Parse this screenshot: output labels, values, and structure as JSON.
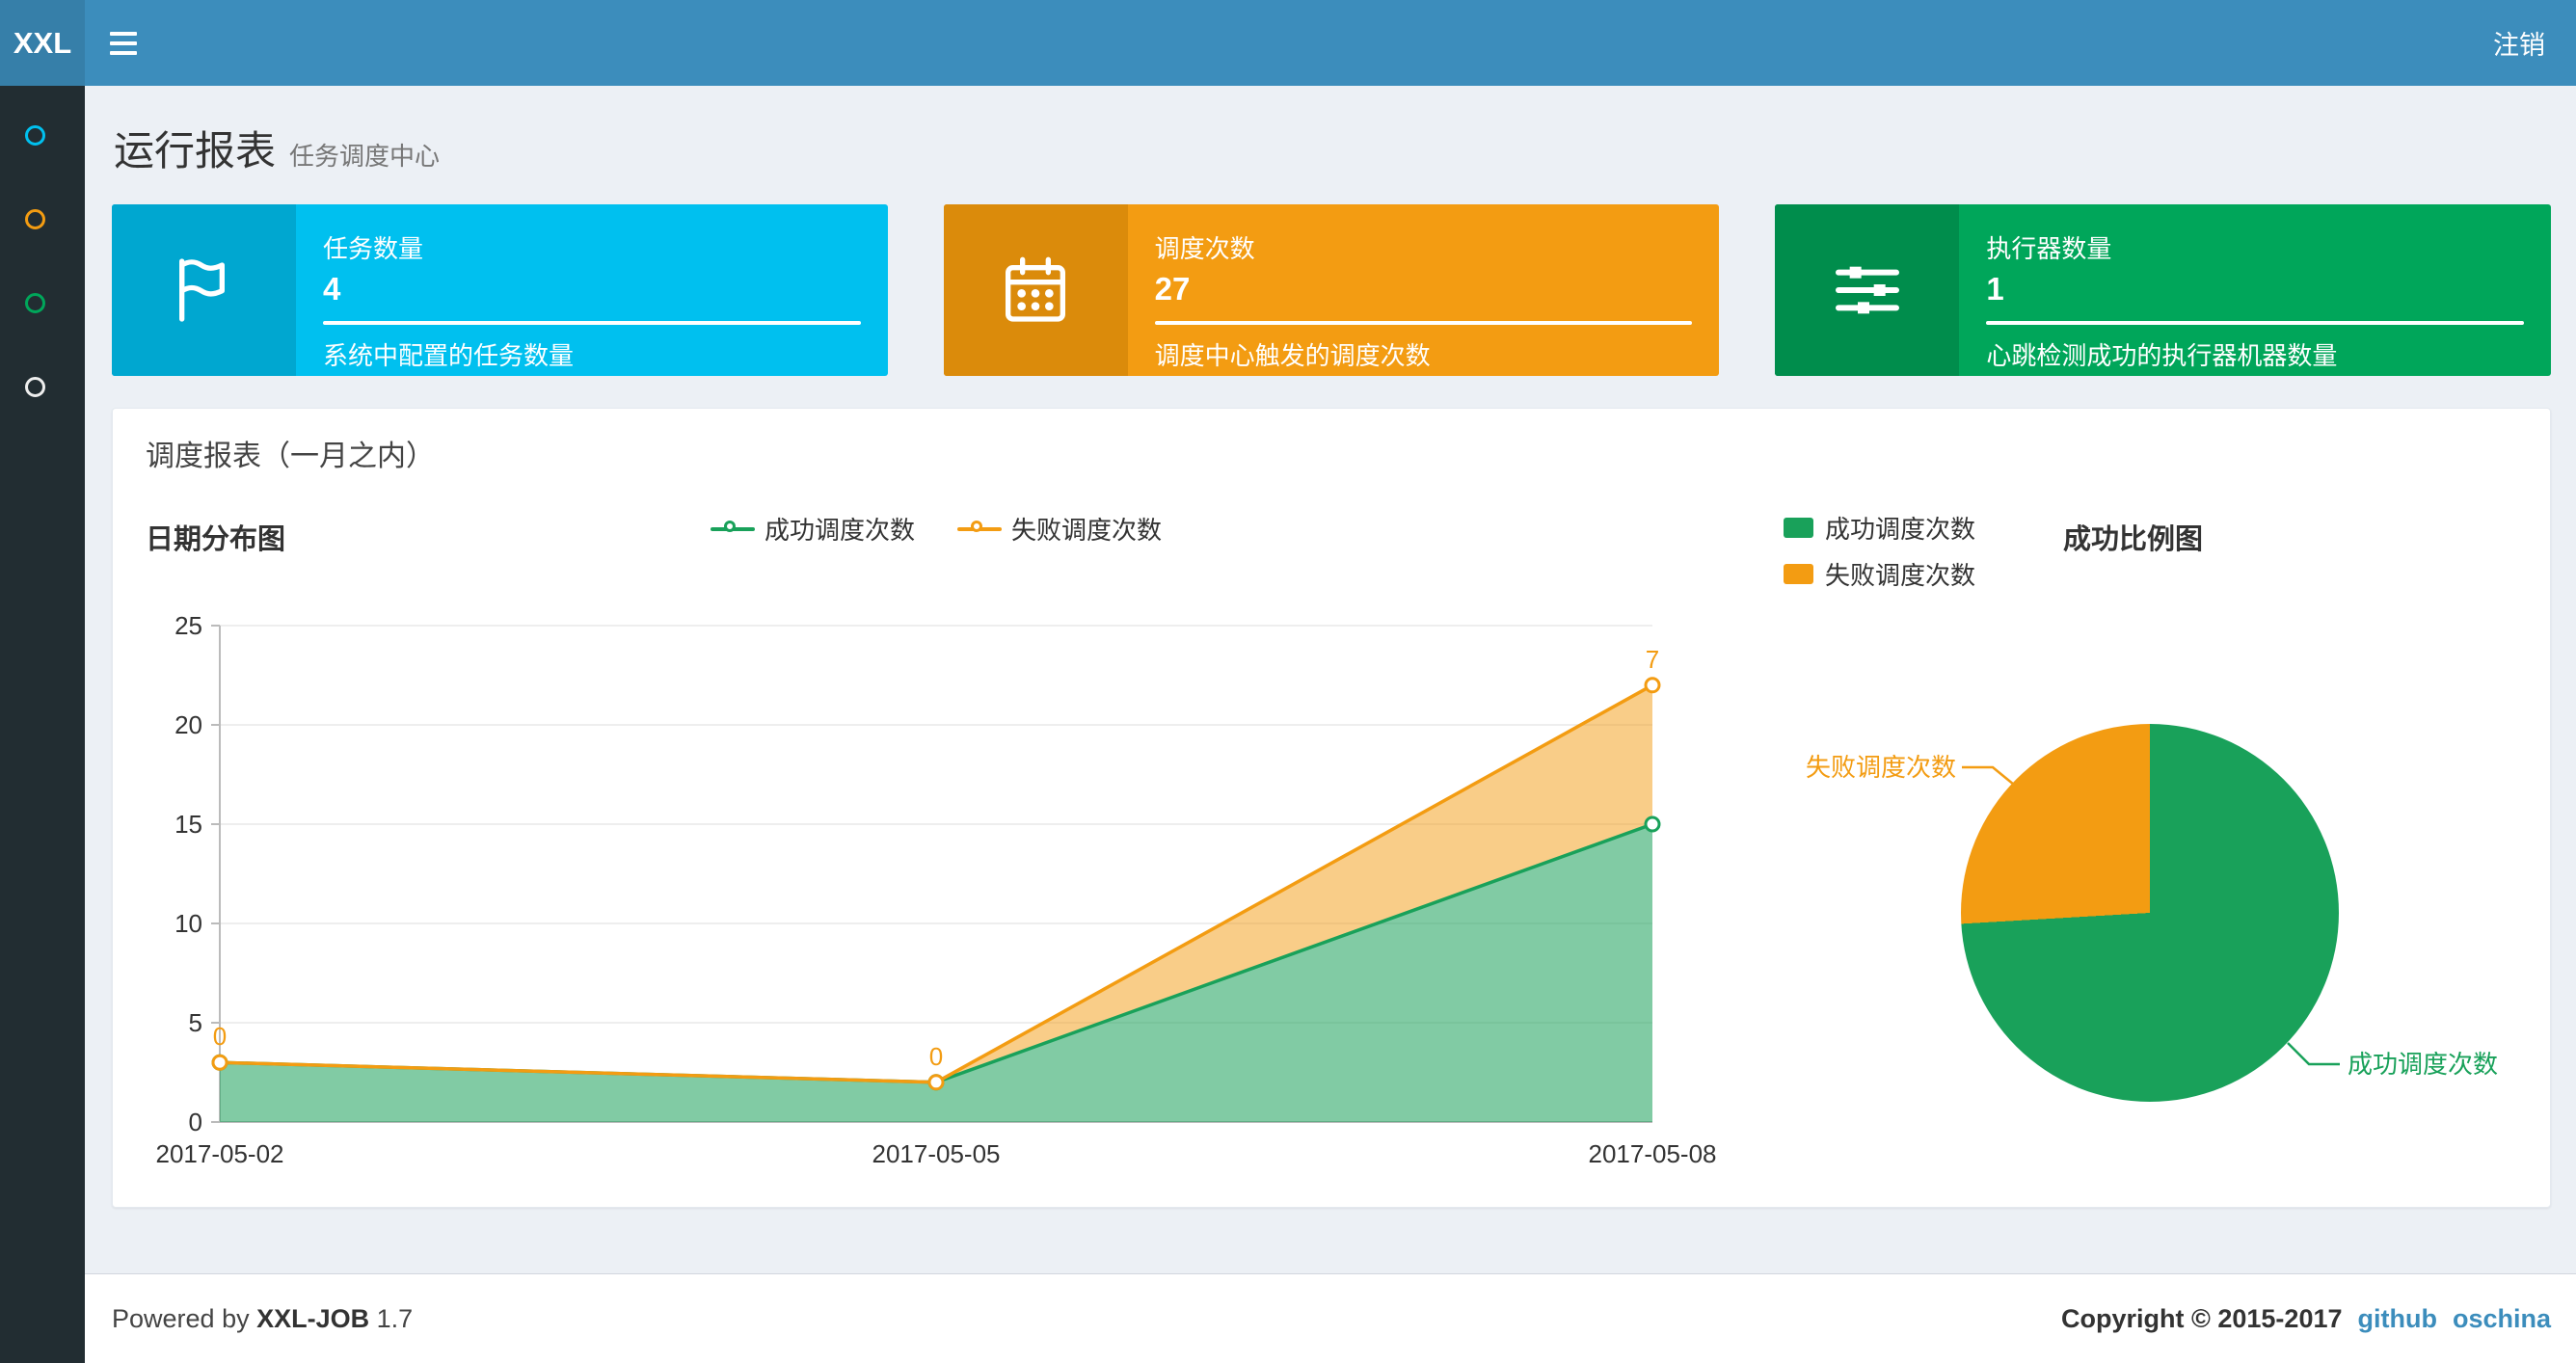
{
  "theme": {
    "navbar": "#3c8dbc",
    "logo_bg": "#367fa9",
    "sidebar": "#222d32",
    "background": "#ecf0f5",
    "link_color": "#3c8dbc"
  },
  "navbar": {
    "logo": "XXL",
    "logout": "注销"
  },
  "sidebar": {
    "items": [
      {
        "icon": "circle-o-icon",
        "color": "#00c0ef"
      },
      {
        "icon": "circle-o-icon",
        "color": "#f39c12"
      },
      {
        "icon": "circle-o-icon",
        "color": "#00a65a"
      },
      {
        "icon": "circle-o-icon",
        "color": "#eeeeee"
      }
    ]
  },
  "header": {
    "title": "运行报表",
    "subtitle": "任务调度中心"
  },
  "info_boxes": [
    {
      "icon": "flag-icon",
      "title": "任务数量",
      "value": "4",
      "desc": "系统中配置的任务数量",
      "color": "#00c0ef",
      "icon_bg": "#00a7d0"
    },
    {
      "icon": "calendar-icon",
      "title": "调度次数",
      "value": "27",
      "desc": "调度中心触发的调度次数",
      "color": "#f39c12",
      "icon_bg": "#db8b0b"
    },
    {
      "icon": "sliders-icon",
      "title": "执行器数量",
      "value": "1",
      "desc": "心跳检测成功的执行器机器数量",
      "color": "#00a65a",
      "icon_bg": "#008d4c"
    }
  ],
  "panel": {
    "title": "调度报表（一月之内）"
  },
  "chart_data": [
    {
      "type": "area",
      "title": "日期分布图",
      "x": [
        "2017-05-02",
        "2017-05-05",
        "2017-05-08"
      ],
      "series": [
        {
          "name": "成功调度次数",
          "color": "#19a15a",
          "values": [
            3,
            2,
            15
          ]
        },
        {
          "name": "失败调度次数",
          "color": "#f39c12",
          "values": [
            0,
            0,
            7
          ],
          "labels": [
            "0",
            "0",
            "7"
          ]
        }
      ],
      "stacked": true,
      "ylim": [
        0,
        25
      ],
      "yticks": [
        0,
        5,
        10,
        15,
        20,
        25
      ],
      "legend_position": "top",
      "grid": true
    },
    {
      "type": "pie",
      "title": "成功比例图",
      "slices": [
        {
          "name": "成功调度次数",
          "value": 20,
          "color": "#19a15a"
        },
        {
          "name": "失败调度次数",
          "value": 7,
          "color": "#f39c12"
        }
      ],
      "legend_position": "top-left"
    }
  ],
  "footer": {
    "powered_by": "Powered by",
    "brand": "XXL-JOB",
    "version": "1.7",
    "copyright": "Copyright © 2015-2017",
    "links": [
      "github",
      "oschina"
    ]
  }
}
